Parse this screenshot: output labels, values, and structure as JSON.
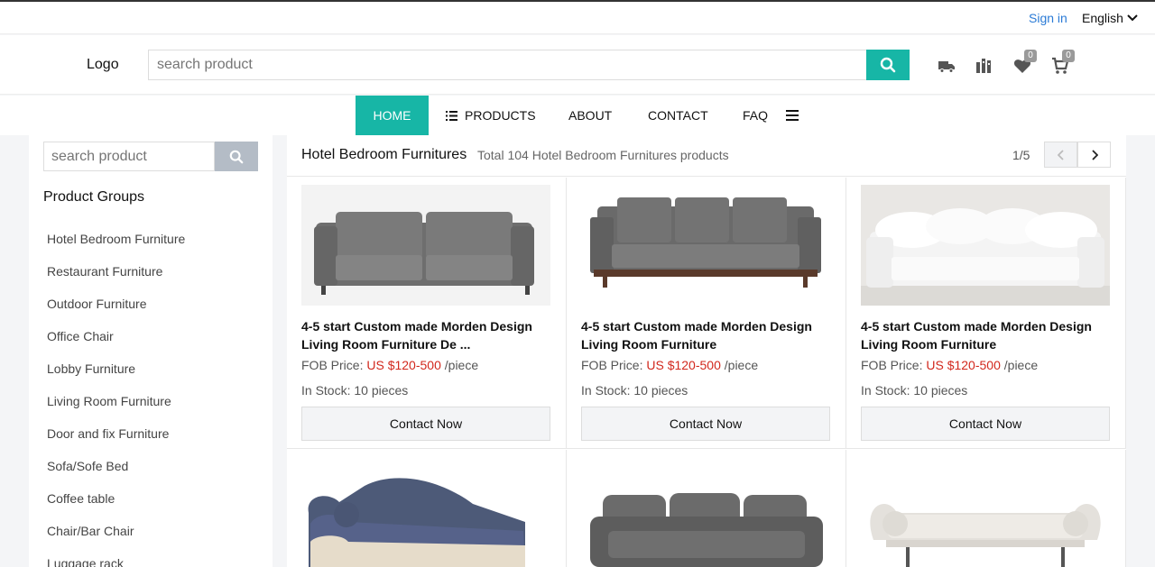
{
  "topbar": {
    "signin": "Sign in",
    "language": "English"
  },
  "header": {
    "logo": "Logo",
    "search_placeholder": "search product",
    "wishlist_count": "0",
    "cart_count": "0"
  },
  "nav": {
    "home": "HOME",
    "products": "PRODUCTS",
    "about": "ABOUT",
    "contact": "CONTACT",
    "faq": "FAQ"
  },
  "sidebar": {
    "search_placeholder": "search product",
    "groups_title": "Product Groups",
    "groups": [
      "Hotel Bedroom Furniture",
      "Restaurant Furniture",
      "Outdoor Furniture",
      "Office Chair",
      "Lobby Furniture",
      "Living Room Furniture",
      "Door and fix Furniture",
      "Sofa/Sofe Bed",
      "Coffee table",
      "Chair/Bar Chair",
      "Luggage rack"
    ]
  },
  "main": {
    "category_title": "Hotel Bedroom Furnitures",
    "category_total": "Total 104 Hotel Bedroom Furnitures products",
    "page": "1/5"
  },
  "products": [
    {
      "title": "4-5 start Custom made Morden Design Living Room Furniture De ...",
      "price_label": "FOB Price:",
      "price": "US $120-500",
      "unit": "/piece",
      "stock": "In Stock: 10 pieces",
      "button": "Contact Now"
    },
    {
      "title": "4-5 start Custom made Morden Design Living Room Furniture",
      "price_label": "FOB Price:",
      "price": "US $120-500",
      "unit": "/piece",
      "stock": "In Stock: 10 pieces",
      "button": "Contact Now"
    },
    {
      "title": "4-5 start Custom made Morden Design Living Room Furniture",
      "price_label": "FOB Price:",
      "price": "US $120-500",
      "unit": "/piece",
      "stock": "In Stock: 10 pieces",
      "button": "Contact Now"
    }
  ],
  "colors": {
    "accent": "#17b6a6",
    "link": "#2b7bd6",
    "price": "#d2281d"
  }
}
